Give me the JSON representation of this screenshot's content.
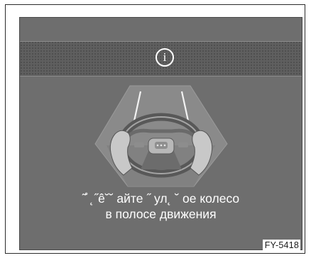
{
  "display": {
    "info_icon_glyph": "i",
    "icon": "info-circle-icon",
    "message_line1": "˜̊ ˛˝ê˘˘ айте ˝ ул˛ ˘ ое колесо",
    "message_line2": "в полосе движения"
  },
  "figure": {
    "code": "FY-5418"
  },
  "colors": {
    "screen_bg": "#6e6e6e",
    "band_bg": "#5f5f5f",
    "text": "#ffffff"
  }
}
